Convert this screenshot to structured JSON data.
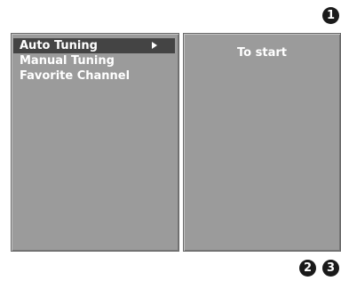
{
  "badges": [
    "1",
    "2",
    "3"
  ],
  "menu": {
    "items": [
      {
        "label": "Auto Tuning",
        "selected": true,
        "has_submenu": true
      },
      {
        "label": "Manual Tuning",
        "selected": false,
        "has_submenu": false
      },
      {
        "label": "Favorite Channel",
        "selected": false,
        "has_submenu": false
      }
    ]
  },
  "info_panel": {
    "text": "To start"
  },
  "colors": {
    "panel": "#9b9b9b",
    "highlight": "#444444",
    "text": "#ffffff"
  },
  "icons": {
    "submenu_arrow": "arrow-right-icon"
  }
}
